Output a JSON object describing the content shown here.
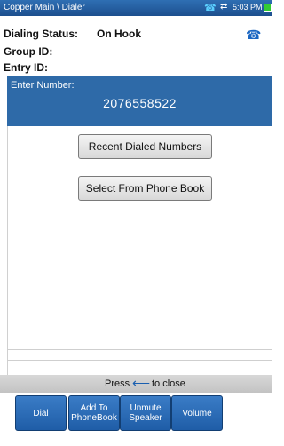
{
  "titlebar": {
    "title": "Copper Main \\ Dialer",
    "phone_icon": "telephone-icon",
    "sync_icon": "swap-arrows-icon",
    "time": "5:03 PM",
    "battery_icon": "battery-icon"
  },
  "status": {
    "dialing_label": "Dialing Status:",
    "dialing_value": "On Hook",
    "group_label": "Group ID:",
    "entry_label": "Entry ID:",
    "hook_icon": "on-hook-phone-icon"
  },
  "entry": {
    "label": "Enter Number:",
    "number": "2076558522"
  },
  "buttons": {
    "recent": "Recent Dialed Numbers",
    "phonebook": "Select From Phone Book"
  },
  "footer": {
    "press_text": "Press",
    "close_text": "to close",
    "arrow_icon": "back-arrow-icon"
  },
  "softkeys": [
    {
      "label": "Dial"
    },
    {
      "label": "Add To PhoneBook"
    },
    {
      "label": "Unmute Speaker"
    },
    {
      "label": "Volume"
    }
  ],
  "colors": {
    "titlebar": "#2f6fb3",
    "entry_panel": "#2e6aa8",
    "softkey": "#2a6db8",
    "battery": "#33cc33"
  }
}
